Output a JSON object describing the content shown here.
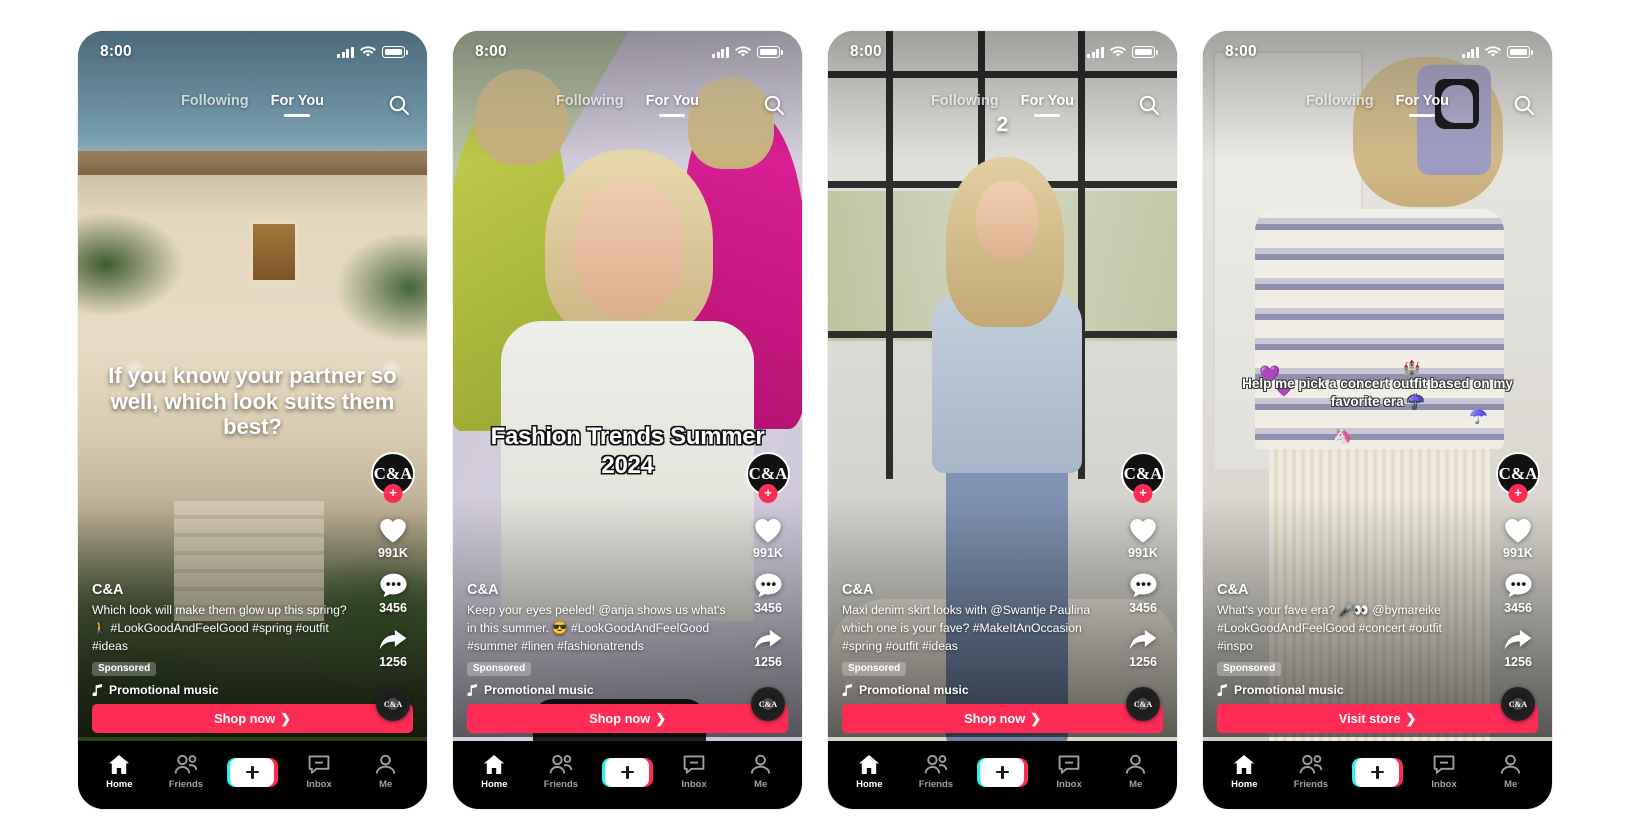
{
  "status_bar": {
    "time": "8:00",
    "signal_icon": "cellular-bars-icon",
    "wifi_icon": "wifi-icon",
    "battery_icon": "battery-icon"
  },
  "top_nav": {
    "following_label": "Following",
    "foryou_label": "For You",
    "search_icon": "search-icon"
  },
  "brand": {
    "name": "C&A",
    "avatar_initials": "C&A",
    "follow_badge": "+"
  },
  "actions": {
    "like_count": "991K",
    "comment_count": "3456",
    "share_count": "1256",
    "like_icon": "heart-icon",
    "comment_icon": "comment-icon",
    "share_icon": "share-arrow-icon",
    "music_disc_icon": "music-disc-icon",
    "music_disc_label": "C&A"
  },
  "labels": {
    "sponsored": "Sponsored",
    "music": "Promotional music",
    "music_icon": "music-note-icon",
    "cta_chevron": "❯"
  },
  "tabbar": {
    "items": [
      {
        "label": "Home",
        "icon": "home-icon",
        "active": true
      },
      {
        "label": "Friends",
        "icon": "friends-icon",
        "active": false
      },
      {
        "label": "",
        "icon": "create-plus-icon",
        "active": false
      },
      {
        "label": "Inbox",
        "icon": "inbox-icon",
        "active": false
      },
      {
        "label": "Me",
        "icon": "profile-icon",
        "active": false
      }
    ]
  },
  "colors": {
    "cta_pink": "#FE2C55",
    "tiktok_cyan": "#25F4EE",
    "nav_black": "#000000",
    "text_white": "#FFFFFF"
  },
  "phones": [
    {
      "id": "phone-1",
      "video_overlay_text": "If you know your partner so well, which look suits them best?",
      "caption": "Which look will make them glow up this spring? 🚶 #LookGoodAndFeelGood #spring #outfit #ideas",
      "cta_label": "Shop now",
      "number_tag": ""
    },
    {
      "id": "phone-2",
      "video_overlay_text": "Fashion Trends Summer 2024",
      "caption": "Keep your eyes peeled! @anja shows us what's in this summer. 😎 #LookGoodAndFeelGood #summer #linen #fashionatrends",
      "cta_label": "Shop now",
      "number_tag": ""
    },
    {
      "id": "phone-3",
      "video_overlay_text": "",
      "caption": "Maxi denim skirt looks with @Swantje Paulina which one is your fave? #MakeItAnOccasion #spring #outfit #ideas",
      "cta_label": "Shop now",
      "number_tag": "2"
    },
    {
      "id": "phone-4",
      "video_overlay_text": "Help me pick a concert outfit based on my favorite era ☂️",
      "caption": "What's your fave era? 🎤👀 @bymareike #LookGoodAndFeelGood #concert #outfit #inspo",
      "cta_label": "Visit store",
      "number_tag": ""
    }
  ]
}
